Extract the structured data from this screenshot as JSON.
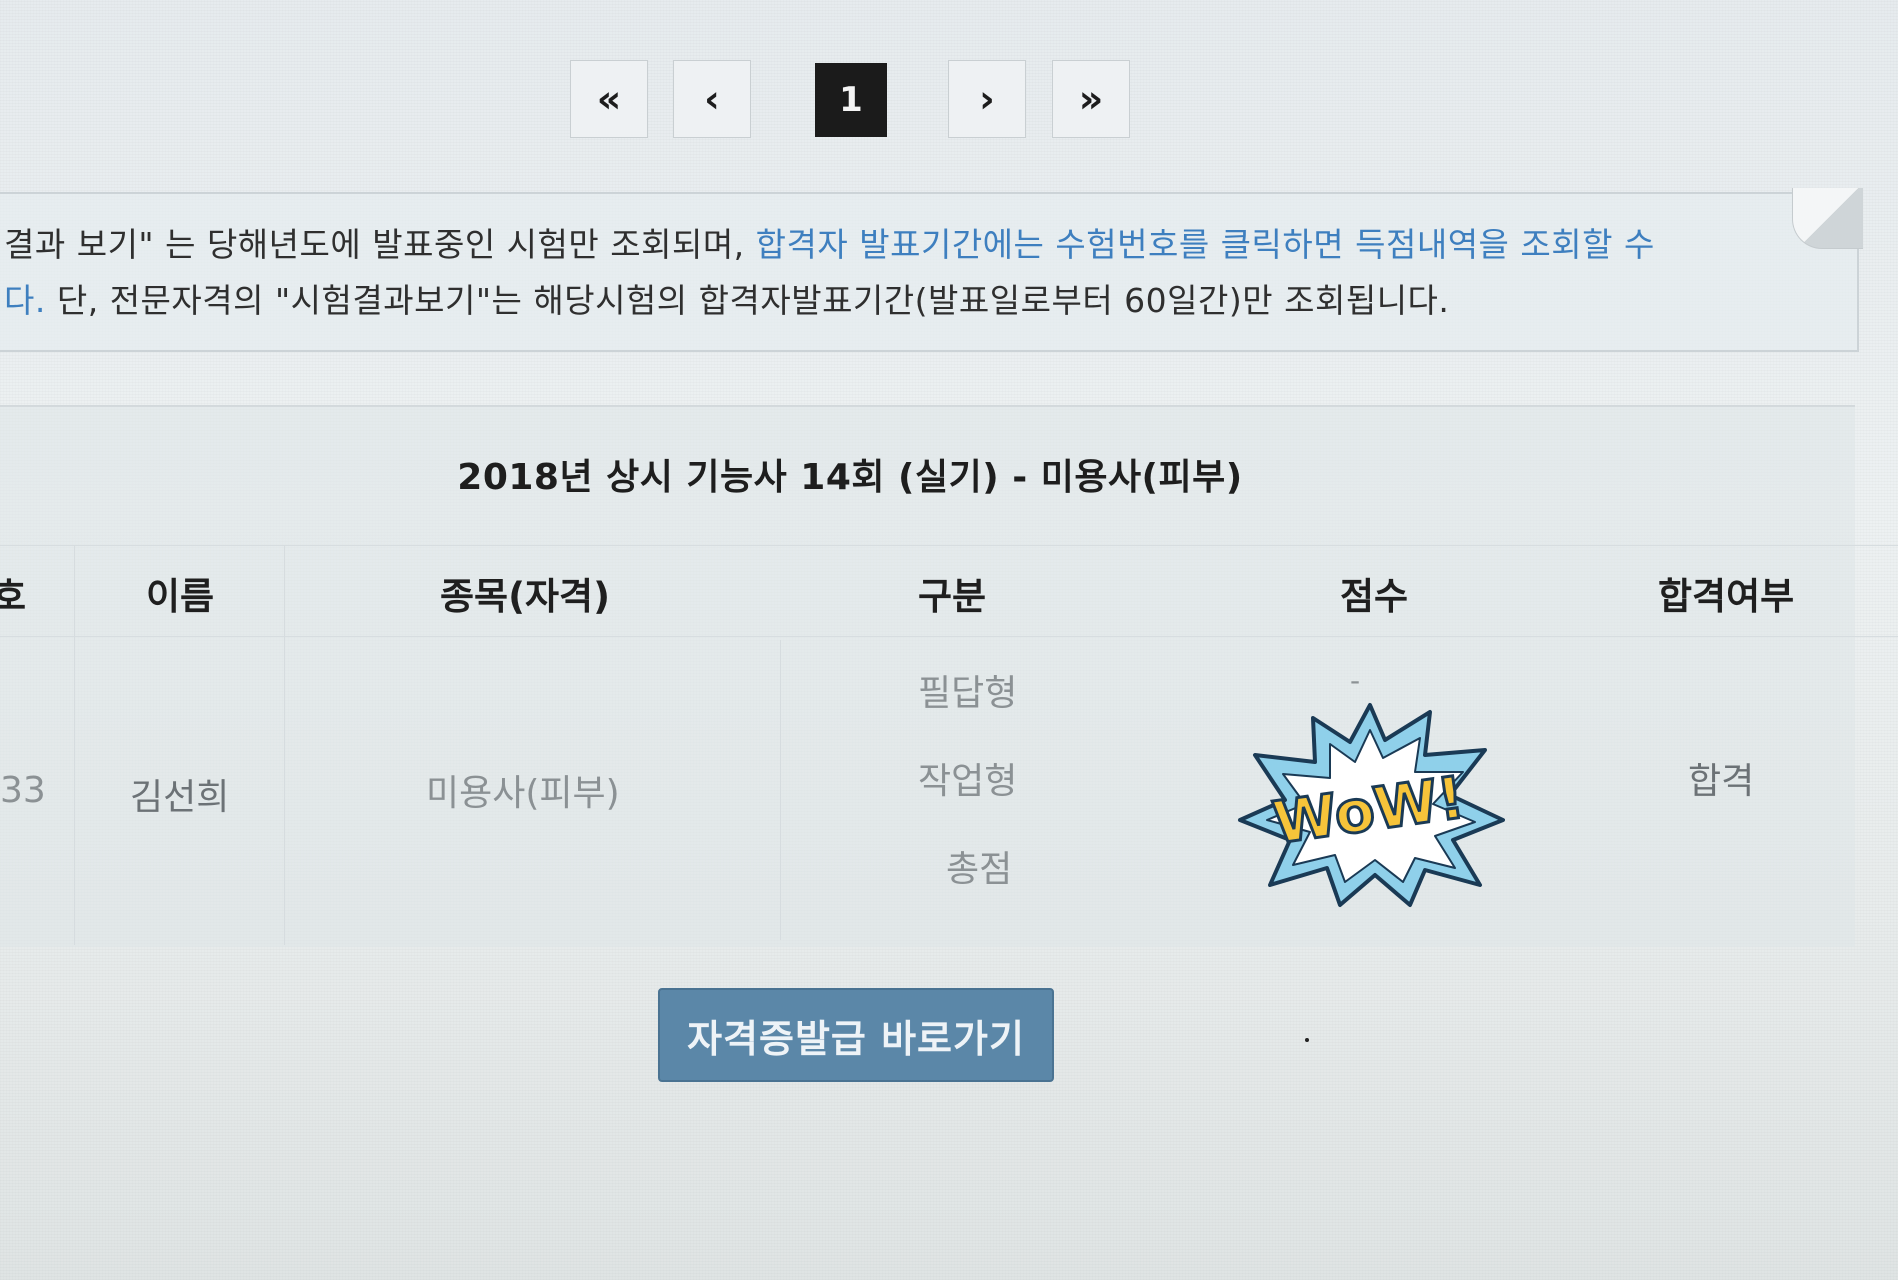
{
  "pagination": {
    "first": "«",
    "prev": "‹",
    "current": "1",
    "next": "›",
    "last": "»"
  },
  "notice": {
    "line1_text": "결과 보기\" 는 당해년도에 발표중인 시험만 조회되며, ",
    "line1_link": "합격자 발표기간에는 수험번호를 클릭하면 득점내역을 조회할 수",
    "line2_link": "다.",
    "line2_text": " 단, 전문자격의 \"시험결과보기\"는 해당시험의 합격자발표기간(발표일로부터 60일간)만 조회됩니다."
  },
  "result": {
    "title": "2018년 상시 기능사 14회 (실기) - 미용사(피부)",
    "headers": {
      "number": "호",
      "name": "이름",
      "subject": "종목(자격)",
      "category": "구분",
      "score": "점수",
      "pass": "합격여부"
    },
    "row": {
      "number": "33",
      "name": "김선희",
      "subject": "미용사(피부)",
      "categories": [
        "필답형",
        "작업형",
        "총점"
      ],
      "score_written": "-",
      "pass": "합격"
    }
  },
  "issue_button": "자격증발급 바로가기",
  "sticker": {
    "text": "WoW!",
    "colors": {
      "burst": "#8fd0ea",
      "burst_outline": "#1a3a55",
      "inner": "#ffffff",
      "letters": "#f6c43a"
    }
  }
}
